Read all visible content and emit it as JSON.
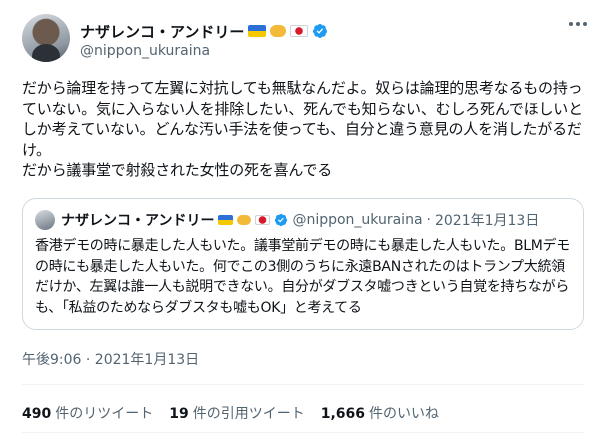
{
  "author": {
    "display_name": "ナザレンコ・アンドリー",
    "handle": "@nippon_ukuraina",
    "icons": [
      "ukraine-flag-icon",
      "handshake-icon",
      "japan-flag-icon",
      "verified-badge-icon"
    ]
  },
  "tweet": {
    "text": "だから論理を持って左翼に対抗しても無駄なんだよ。奴らは論理的思考なるもの持っていない。気に入らない人を排除したい、死んでも知らない、むしろ死んでほしいとしか考えていない。どんな汚い手法を使っても、自分と違う意見の人を消したがるだけ。\nだから議事堂で射殺された女性の死を喜んでる",
    "timestamp": "午後9:06 · 2021年1月13日"
  },
  "quoted_tweet": {
    "display_name": "ナザレンコ・アンドリー",
    "handle": "@nippon_ukuraina",
    "separator": "·",
    "date": "2021年1月13日",
    "text": "香港デモの時に暴走した人もいた。議事堂前デモの時にも暴走した人もいた。BLMデモの時にも暴走した人もいた。何でこの3側のうちに永遠BANされたのはトランプ大統領だけか、左翼は誰一人も説明できない。自分がダブスタ嘘つきという自覚を持ちながらも、「私益のためならダブスタも嘘もOK」と考えてる"
  },
  "stats": {
    "retweets": {
      "count": "490",
      "label": "件のリツイート"
    },
    "quotes": {
      "count": "19",
      "label": "件の引用ツイート"
    },
    "likes": {
      "count": "1,666",
      "label": "件のいいね"
    }
  },
  "colors": {
    "text": "#0f1419",
    "secondary": "#536471",
    "verified": "#1d9bf0",
    "border": "#cfd9de"
  }
}
